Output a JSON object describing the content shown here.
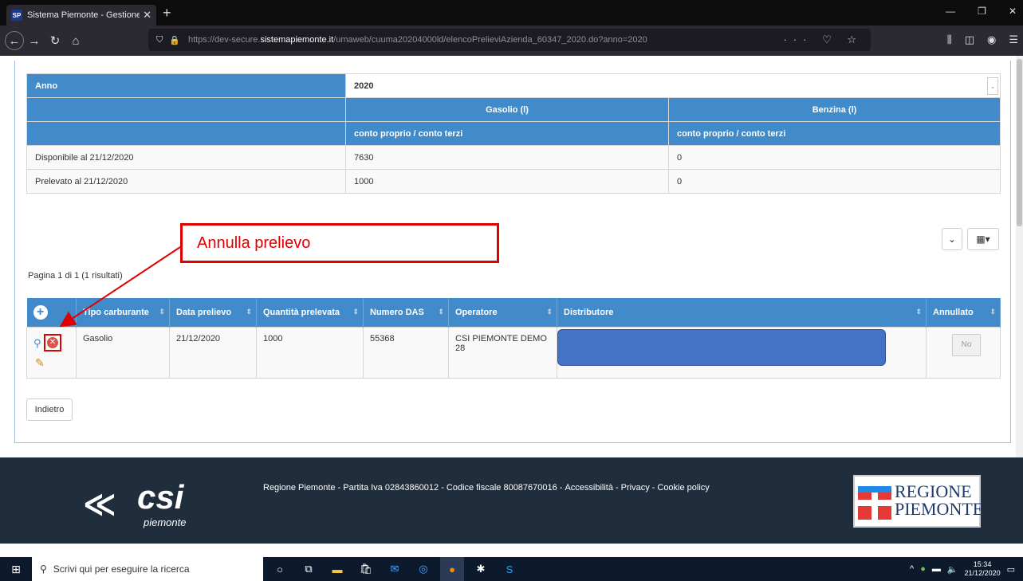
{
  "browser": {
    "tab_title": "Sistema Piemonte - Gestione a",
    "tab_favicon": "SP",
    "url_prefix": "https://dev-secure.",
    "url_domain": "sistemapiemonte.it",
    "url_path": "/umaweb/cuuma20204000ld/elencoPrelieviAzienda_60347_2020.do?anno=2020"
  },
  "summary": {
    "anno_label": "Anno",
    "anno_value": "2020",
    "gasolio_header": "Gasolio (l)",
    "benzina_header": "Benzina (l)",
    "sub_gasolio": "conto proprio / conto terzi",
    "sub_benzina": "conto proprio / conto terzi",
    "rows": [
      {
        "label": "Disponibile al 21/12/2020",
        "gasolio": "7630",
        "benzina": "0"
      },
      {
        "label": "Prelevato al 21/12/2020",
        "gasolio": "1000",
        "benzina": "0"
      }
    ]
  },
  "pagination": "Pagina 1 di 1 (1 risultati)",
  "grid": {
    "columns": [
      "Tipo carburante",
      "Data prelievo",
      "Quantità prelevata",
      "Numero DAS",
      "Operatore",
      "Distributore",
      "Annullato"
    ],
    "rows": [
      {
        "tipo": "Gasolio",
        "data": "21/12/2020",
        "quantita": "1000",
        "das": "55368",
        "operatore": "CSI PIEMONTE DEMO 28",
        "distributore": "",
        "annullato": "No"
      }
    ]
  },
  "back_button": "Indietro",
  "annotation": {
    "callout_text": "Annulla prelievo",
    "color": "#e00000"
  },
  "footer": {
    "csi_word": "csi",
    "csi_sub": "piemonte",
    "links": [
      "Regione Piemonte - Partita Iva 02843860012 - Codice fiscale 80087670016",
      "Accessibilità",
      "Privacy",
      "Cookie policy"
    ],
    "regione_line1": "REGIONE",
    "regione_line2": "PIEMONTE"
  },
  "taskbar": {
    "search_placeholder": "Scrivi qui per eseguire la ricerca",
    "time": "15:34",
    "date": "21/12/2020"
  },
  "colors": {
    "header_blue": "#428bca",
    "footer_bg": "#1f2d3d",
    "redacted": "#4472c4"
  }
}
